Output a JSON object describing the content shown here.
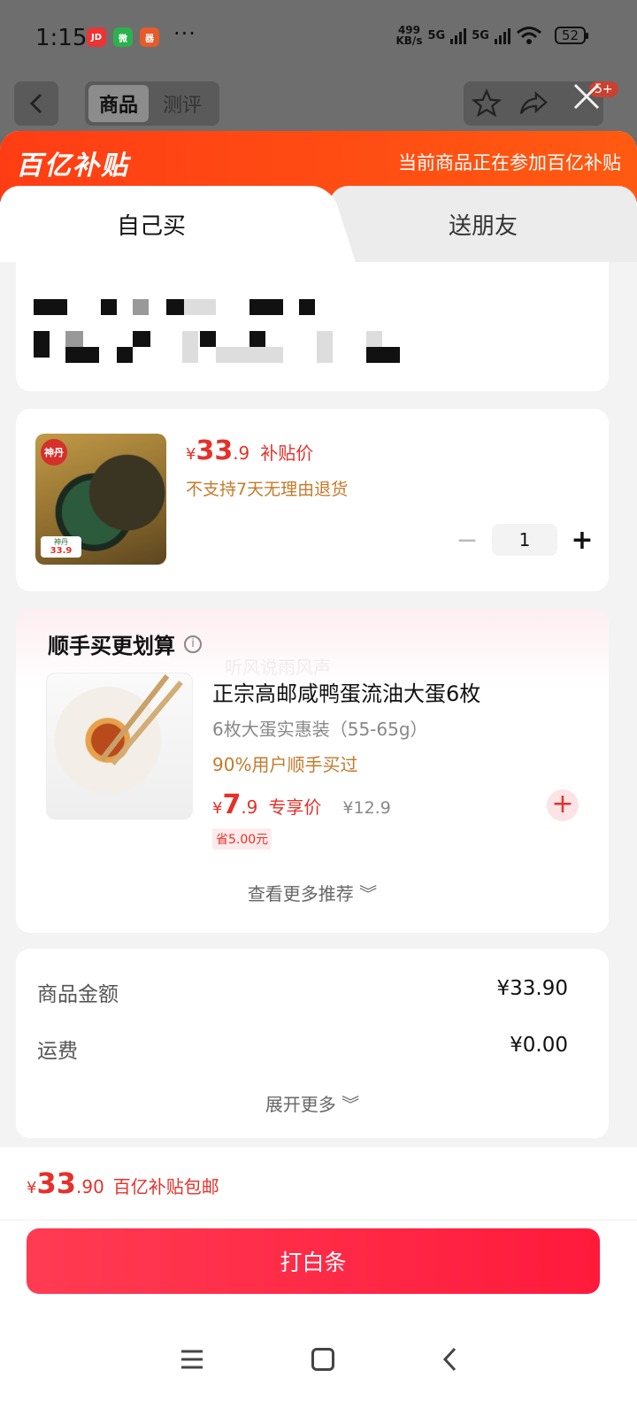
{
  "status": {
    "time": "1:15",
    "apps": [
      "JD",
      "微",
      "器"
    ],
    "more": "···",
    "net_speed_top": "499",
    "net_speed_unit": "KB/s",
    "sig1": "5G",
    "sig2": "5G",
    "battery": "52"
  },
  "topnav": {
    "tab_product": "商品",
    "tab_review": "测评",
    "badge": "5+"
  },
  "sheet": {
    "brand": "百亿补贴",
    "brand_note": "当前商品正在参加百亿补贴",
    "tab_self": "自己买",
    "tab_gift": "送朋友"
  },
  "product": {
    "logo": "神丹",
    "tag_top": "神丹",
    "tag_price": "33.9",
    "currency": "¥",
    "price_int": "33",
    "price_dec": ".9",
    "price_label": "补贴价",
    "no_return": "不支持7天无理由退货",
    "quantity": "1",
    "minus": "−",
    "plus": "+"
  },
  "recommend": {
    "title": "顺手买更划算",
    "info": "i",
    "watermark": "听风说雨风声",
    "name": "正宗高邮咸鸭蛋流油大蛋6枚",
    "spec": "6枚大蛋实惠装（55-65g）",
    "users": "90%用户顺手买过",
    "currency": "¥",
    "price_int": "7",
    "price_dec": ".9",
    "price_label": "专享价",
    "orig_price": "¥12.9",
    "save": "省5.00元",
    "add": "+",
    "more": "查看更多推荐 ︾"
  },
  "summary": {
    "amount_label": "商品金额",
    "amount_value": "¥33.90",
    "shipping_label": "运费",
    "shipping_value": "¥0.00",
    "more": "展开更多 ︾"
  },
  "bottom": {
    "currency": "¥",
    "total_int": "33",
    "total_dec": ".90",
    "total_note": "百亿补贴包邮",
    "pay_label": "打白条"
  }
}
